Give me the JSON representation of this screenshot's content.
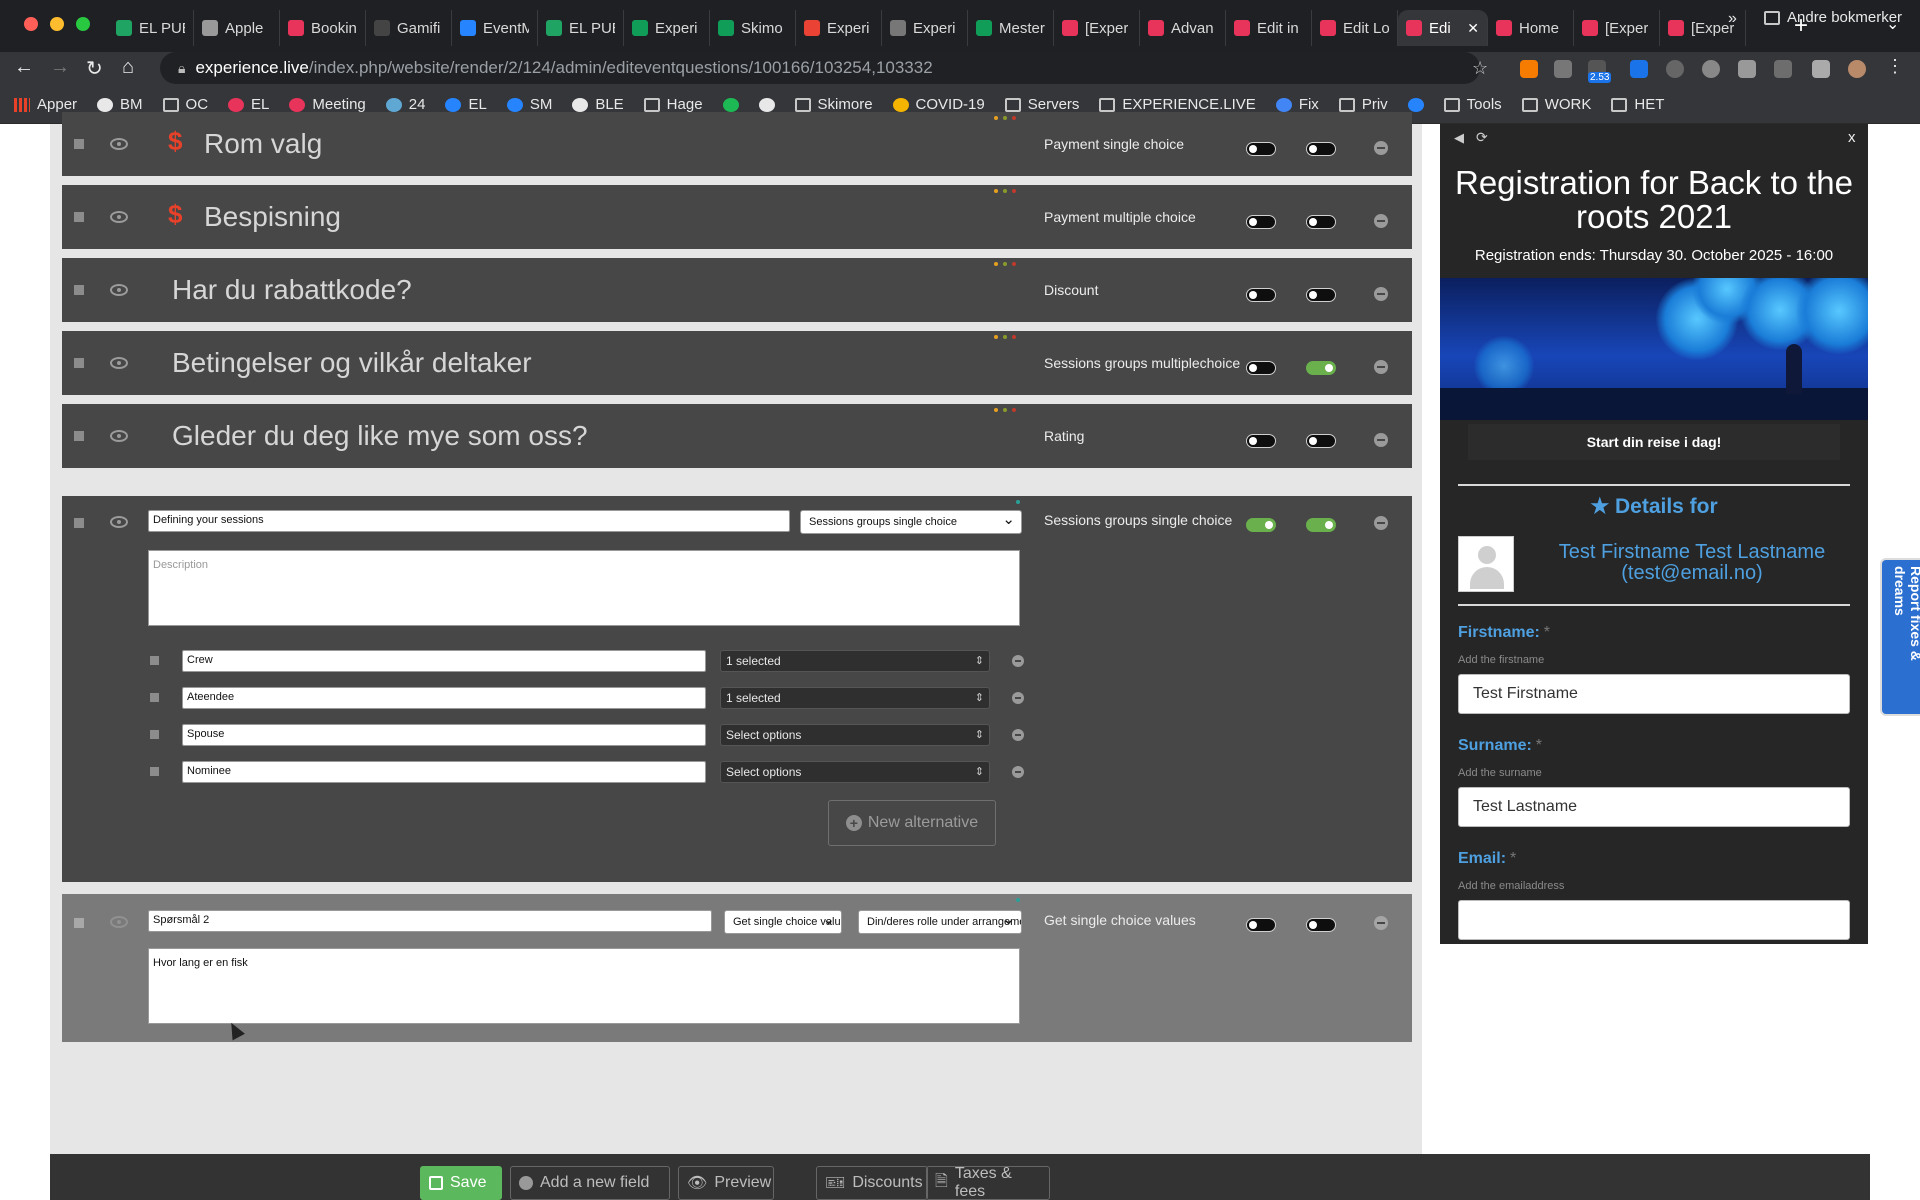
{
  "browser": {
    "tabs": [
      {
        "title": "EL PUB",
        "icon": "drive-icon",
        "color": "#1fa463"
      },
      {
        "title": "Apple",
        "icon": "apple-icon",
        "color": "#999999"
      },
      {
        "title": "Booking",
        "icon": "experience-icon",
        "color": "#e8335a"
      },
      {
        "title": "Gamifi",
        "icon": "gamification-icon",
        "color": "#444444"
      },
      {
        "title": "EventM",
        "icon": "jira-icon",
        "color": "#2684ff"
      },
      {
        "title": "EL PUB",
        "icon": "drive-icon",
        "color": "#1fa463"
      },
      {
        "title": "Experi",
        "icon": "sheets-icon",
        "color": "#0f9d58"
      },
      {
        "title": "Skimo",
        "icon": "sheets-icon",
        "color": "#0f9d58"
      },
      {
        "title": "Experi",
        "icon": "gmail-icon",
        "color": "#ea4335"
      },
      {
        "title": "Experi",
        "icon": "globe-icon",
        "color": "#777777"
      },
      {
        "title": "Mester",
        "icon": "sheets-icon",
        "color": "#0f9d58"
      },
      {
        "title": "[Exper",
        "icon": "experience-icon",
        "color": "#e8335a"
      },
      {
        "title": "Advan",
        "icon": "experience-icon",
        "color": "#e8335a"
      },
      {
        "title": "Edit in",
        "icon": "experience-icon",
        "color": "#e8335a"
      },
      {
        "title": "Edit Lo",
        "icon": "experience-icon",
        "color": "#e8335a"
      },
      {
        "title": "Edi",
        "icon": "experience-icon",
        "color": "#e8335a",
        "active": true
      },
      {
        "title": "Home",
        "icon": "experience-icon",
        "color": "#e8335a"
      },
      {
        "title": "[Exper",
        "icon": "experience-icon",
        "color": "#e8335a"
      },
      {
        "title": "[Exper",
        "icon": "experience-icon",
        "color": "#e8335a"
      }
    ],
    "url_host": "experience.live",
    "url_path": "/index.php/website/render/2/124/admin/editeventquestions/100166/103254,103332",
    "extension_badge": "2.53",
    "bookmarks": [
      {
        "label": "Apper",
        "icon": "apps-grid-icon"
      },
      {
        "label": "BM",
        "icon": "star-icon"
      },
      {
        "label": "OC",
        "icon": "folder-icon"
      },
      {
        "label": "EL",
        "icon": "experience-icon"
      },
      {
        "label": "Meeting",
        "icon": "experience-icon"
      },
      {
        "label": "24",
        "icon": "chart-icon"
      },
      {
        "label": "EL",
        "icon": "jira-icon"
      },
      {
        "label": "SM",
        "icon": "jira-icon"
      },
      {
        "label": "BLE",
        "icon": "globe-icon"
      },
      {
        "label": "Hage",
        "icon": "folder-icon"
      },
      {
        "label": "",
        "icon": "spotify-icon"
      },
      {
        "label": "",
        "icon": "contrast-icon"
      },
      {
        "label": "Skimore",
        "icon": "folder-icon"
      },
      {
        "label": "COVID-19",
        "icon": "covid-icon"
      },
      {
        "label": "Servers",
        "icon": "folder-icon"
      },
      {
        "label": "EXPERIENCE.LIVE",
        "icon": "folder-icon"
      },
      {
        "label": "Fix",
        "icon": "docs-icon"
      },
      {
        "label": "Priv",
        "icon": "folder-icon"
      },
      {
        "label": "",
        "icon": "jira-icon"
      },
      {
        "label": "Tools",
        "icon": "folder-icon"
      },
      {
        "label": "WORK",
        "icon": "folder-icon"
      },
      {
        "label": "HET",
        "icon": "folder-icon"
      }
    ],
    "bookmarks_more": "»",
    "other_bookmarks": "Andre bokmerker"
  },
  "questions": [
    {
      "title": "Rom valg",
      "type": "Payment single choice",
      "payment": true,
      "toggle1": false,
      "toggle2": false
    },
    {
      "title": "Bespisning",
      "type": "Payment multiple choice",
      "payment": true,
      "toggle1": false,
      "toggle2": false
    },
    {
      "title": "Har du rabattkode?",
      "type": "Discount",
      "payment": false,
      "toggle1": false,
      "toggle2": false
    },
    {
      "title": "Betingelser og vilkår deltaker",
      "type": "Sessions groups multiplechoice",
      "payment": false,
      "toggle1": false,
      "toggle2": true
    },
    {
      "title": "Gleder du deg like mye som oss?",
      "type": "Rating",
      "payment": false,
      "toggle1": false,
      "toggle2": false
    }
  ],
  "expanded_question": {
    "name_value": "Defining your sessions",
    "type_select": "Sessions groups single choice",
    "type_label": "Sessions groups single choice",
    "description_placeholder": "Description",
    "toggle1": true,
    "toggle2": true,
    "alternatives": [
      {
        "label": "Crew",
        "selection": "1 selected"
      },
      {
        "label": "Ateendee",
        "selection": "1 selected"
      },
      {
        "label": "Spouse",
        "selection": "Select options"
      },
      {
        "label": "Nominee",
        "selection": "Select options"
      }
    ],
    "new_alternative_label": "New alternative"
  },
  "second_question": {
    "name_value": "Spørsmål 2",
    "type_select": "Get single choice values",
    "source_select": "Din/deres rolle under arrangementet",
    "type_label": "Get single choice values",
    "description_value": "Hvor lang er en fisk",
    "toggle1": false,
    "toggle2": false
  },
  "bottom_bar": {
    "save": "Save",
    "add_field": "Add a new field",
    "preview": "Preview",
    "discounts": "Discounts",
    "taxes": "Taxes & fees"
  },
  "preview": {
    "close": "x",
    "title": "Registration for Back to the roots 2021",
    "ends": "Registration ends: Thursday 30. October 2025 - 16:00",
    "cta": "Start din reise i dag!",
    "details_heading": "Details for",
    "person_name": "Test Firstname Test Lastname",
    "person_email": "(test@email.no)",
    "fields": [
      {
        "label": "Firstname:",
        "required": "*",
        "help": "Add the firstname",
        "value": "Test Firstname"
      },
      {
        "label": "Surname:",
        "required": "*",
        "help": "Add the surname",
        "value": "Test Lastname"
      },
      {
        "label": "Email:",
        "required": "*",
        "help": "Add the emailaddress",
        "value": ""
      }
    ]
  },
  "report_tab": "Report fixes & dreams",
  "colors": {
    "dot_orange": "#e6a020",
    "dot_olive": "#8a9a2a",
    "dot_red": "#c0392b",
    "dot_teal": "#2aa198",
    "toggle_on": "#6ab04c",
    "save_green": "#5cb85c",
    "preview_accent": "#4ea0e0"
  }
}
